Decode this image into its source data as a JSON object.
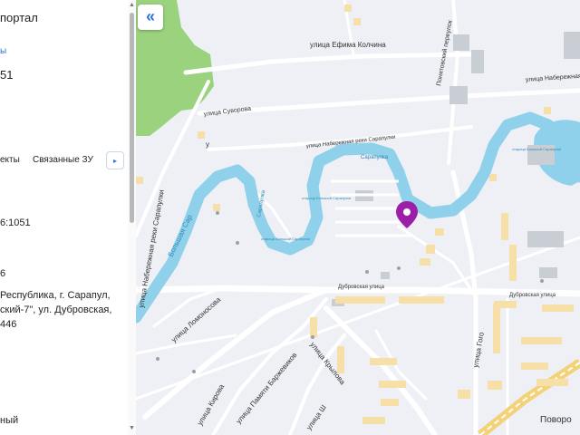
{
  "panel": {
    "portal_fragment": "портал",
    "link_fragment": "ы",
    "number_fragment": "51",
    "tab_fragment": "екты",
    "tab_related": "Связанные ЗУ",
    "cad_number_fragment": "6:1051",
    "line2_fragment": "6",
    "address_line1": "Республика, г. Сарапул,",
    "address_line2": "ский-7\", ул. Дубровская,",
    "address_line3": "446",
    "bottom_fragment": "ный"
  },
  "map": {
    "collapse_glyph": "«",
    "colors": {
      "river": "#8fd0ea",
      "forest": "#9bd27e",
      "marker": "#9c1fa9",
      "road": "#ffffff",
      "building_yellow": "#f7dfa8",
      "building_gray": "#c9cdd4"
    },
    "streets": {
      "efima_kolchina": "улица Ефима Колчина",
      "ponyatovsky": "Понятовский переулок",
      "naberezhnaya_top": "улица Набережная реки",
      "suvorova": "улица Суворова",
      "naberezhnaya_sarapulki": "улица Набережная реки Сарапулки",
      "naberezhnaya_left": "улица Набережная реки Сарапулки",
      "dubrovskaya_left": "Дубровская улица",
      "dubrovskaya_right": "Дубровская улица",
      "lomonosova": "улица Ломоносова",
      "krylova": "улица Крылова",
      "kirova": "улица Кирова",
      "pamyati": "улица Памяти Баржевиков",
      "gogol": "улица Гого",
      "shchorsa": "улица Ш",
      "povorot": "Поворо"
    },
    "rivers": {
      "bolshaya_sarapulka": "Большая Сар",
      "sarapulka_top": "Сарапулка",
      "sarapulka_mid": "Сарапулка"
    },
    "small": {
      "u_fragment": "у",
      "starica1": "старица Большой Сарапулки",
      "starica2": "старица Большой Сарапулки",
      "starica3": "старица Большой Сарапулки"
    }
  }
}
